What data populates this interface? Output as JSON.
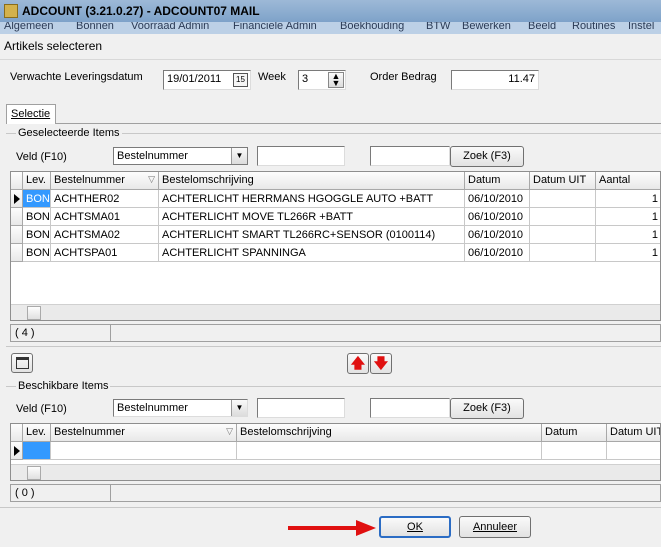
{
  "window": {
    "title": "ADCOUNT (3.21.0.27)  - ADCOUNT07 MAIL"
  },
  "menu": [
    "Algemeen",
    "Bonnen",
    "Voorraad Admin",
    "Financiele Admin",
    "Boekhouding",
    "BTW",
    "Bewerken",
    "Beeld",
    "Routines",
    "Instel"
  ],
  "dialog": {
    "title": "Artikels selecteren"
  },
  "header": {
    "delivery_label": "Verwachte Leveringsdatum",
    "delivery_value": "19/01/2011",
    "week_label": "Week",
    "week_value": "3",
    "order_label": "Order Bedrag",
    "order_value": "11.47"
  },
  "tab": {
    "label": "Selectie"
  },
  "selected": {
    "group_label": "Geselecteerde Items",
    "field_label": "Veld (F10)",
    "field_value": "Bestelnummer",
    "search_button": "Zoek (F3)",
    "columns": [
      "Lev.",
      "Bestelnummer",
      "Bestelomschrijving",
      "Datum",
      "Datum UIT",
      "Aantal"
    ],
    "rows": [
      [
        "BONA",
        "ACHTHER02",
        "ACHTERLICHT HERRMANS HGOGGLE AUTO +BATT",
        "06/10/2010",
        "",
        "1"
      ],
      [
        "BONA",
        "ACHTSMA01",
        "ACHTERLICHT MOVE TL266R +BATT",
        "06/10/2010",
        "",
        "1"
      ],
      [
        "BONA",
        "ACHTSMA02",
        "ACHTERLICHT SMART TL266RC+SENSOR (0100114)",
        "06/10/2010",
        "",
        "1"
      ],
      [
        "BONA",
        "ACHTSPA01",
        "ACHTERLICHT SPANNINGA",
        "06/10/2010",
        "",
        "1"
      ]
    ],
    "count": "( 4 )"
  },
  "available": {
    "group_label": "Beschikbare Items",
    "field_label": "Veld (F10)",
    "field_value": "Bestelnummer",
    "search_button": "Zoek (F3)",
    "columns": [
      "Lev.",
      "Bestelnummer",
      "Bestelomschrijving",
      "Datum",
      "Datum UIT"
    ],
    "count": "( 0 )"
  },
  "footer": {
    "ok_label": "OK",
    "cancel_label": "Annuleer"
  },
  "colors": {
    "arrow_red": "#e01010",
    "selection_blue": "#3399ff"
  }
}
